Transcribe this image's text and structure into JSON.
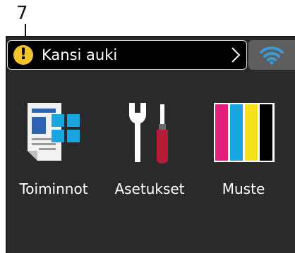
{
  "callout": {
    "number": "7"
  },
  "status_bar": {
    "text": "Kansi auki",
    "icon": "warning-icon",
    "chevron": "chevron-right-icon"
  },
  "wifi": {
    "icon": "wifi-icon"
  },
  "tiles": [
    {
      "label": "Toiminnot",
      "icon": "functions-document-icon"
    },
    {
      "label": "Asetukset",
      "icon": "settings-tools-icon"
    },
    {
      "label": "Muste",
      "icon": "ink-cartridges-icon"
    }
  ],
  "colors": {
    "screen_bg": "#2a2a2a",
    "warning": "#f2c230",
    "wifi_button": "#5e5e5e",
    "wifi_icon": "#3a9bd6",
    "ink_magenta": "#e0207a",
    "ink_cyan": "#1aa6e0",
    "ink_yellow": "#f5e11a",
    "ink_black": "#000000"
  }
}
